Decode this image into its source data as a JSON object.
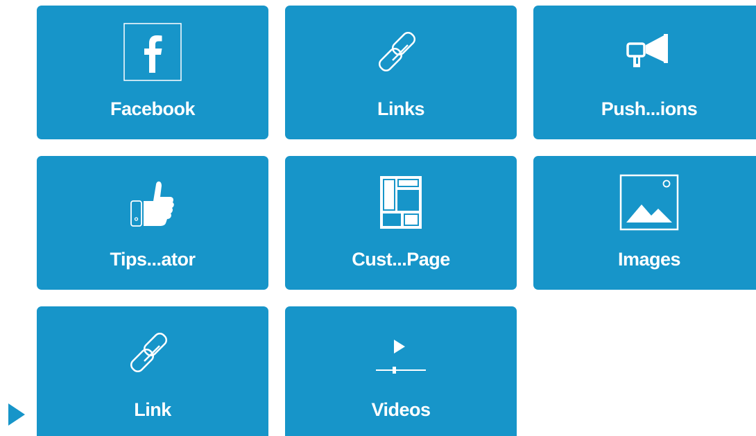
{
  "tiles": [
    {
      "label": "Facebook",
      "icon": "facebook-icon"
    },
    {
      "label": "Links",
      "icon": "link-icon"
    },
    {
      "label": "Push...ions",
      "icon": "megaphone-icon"
    },
    {
      "label": "Tips...ator",
      "icon": "thumbs-up-icon"
    },
    {
      "label": "Cust...Page",
      "icon": "layout-icon"
    },
    {
      "label": "Images",
      "icon": "image-icon"
    },
    {
      "label": "Link",
      "icon": "link-icon"
    },
    {
      "label": "Videos",
      "icon": "video-icon"
    }
  ],
  "colors": {
    "tile_background": "#1795c9",
    "tile_foreground": "#ffffff",
    "page_background": "#ffffff"
  }
}
